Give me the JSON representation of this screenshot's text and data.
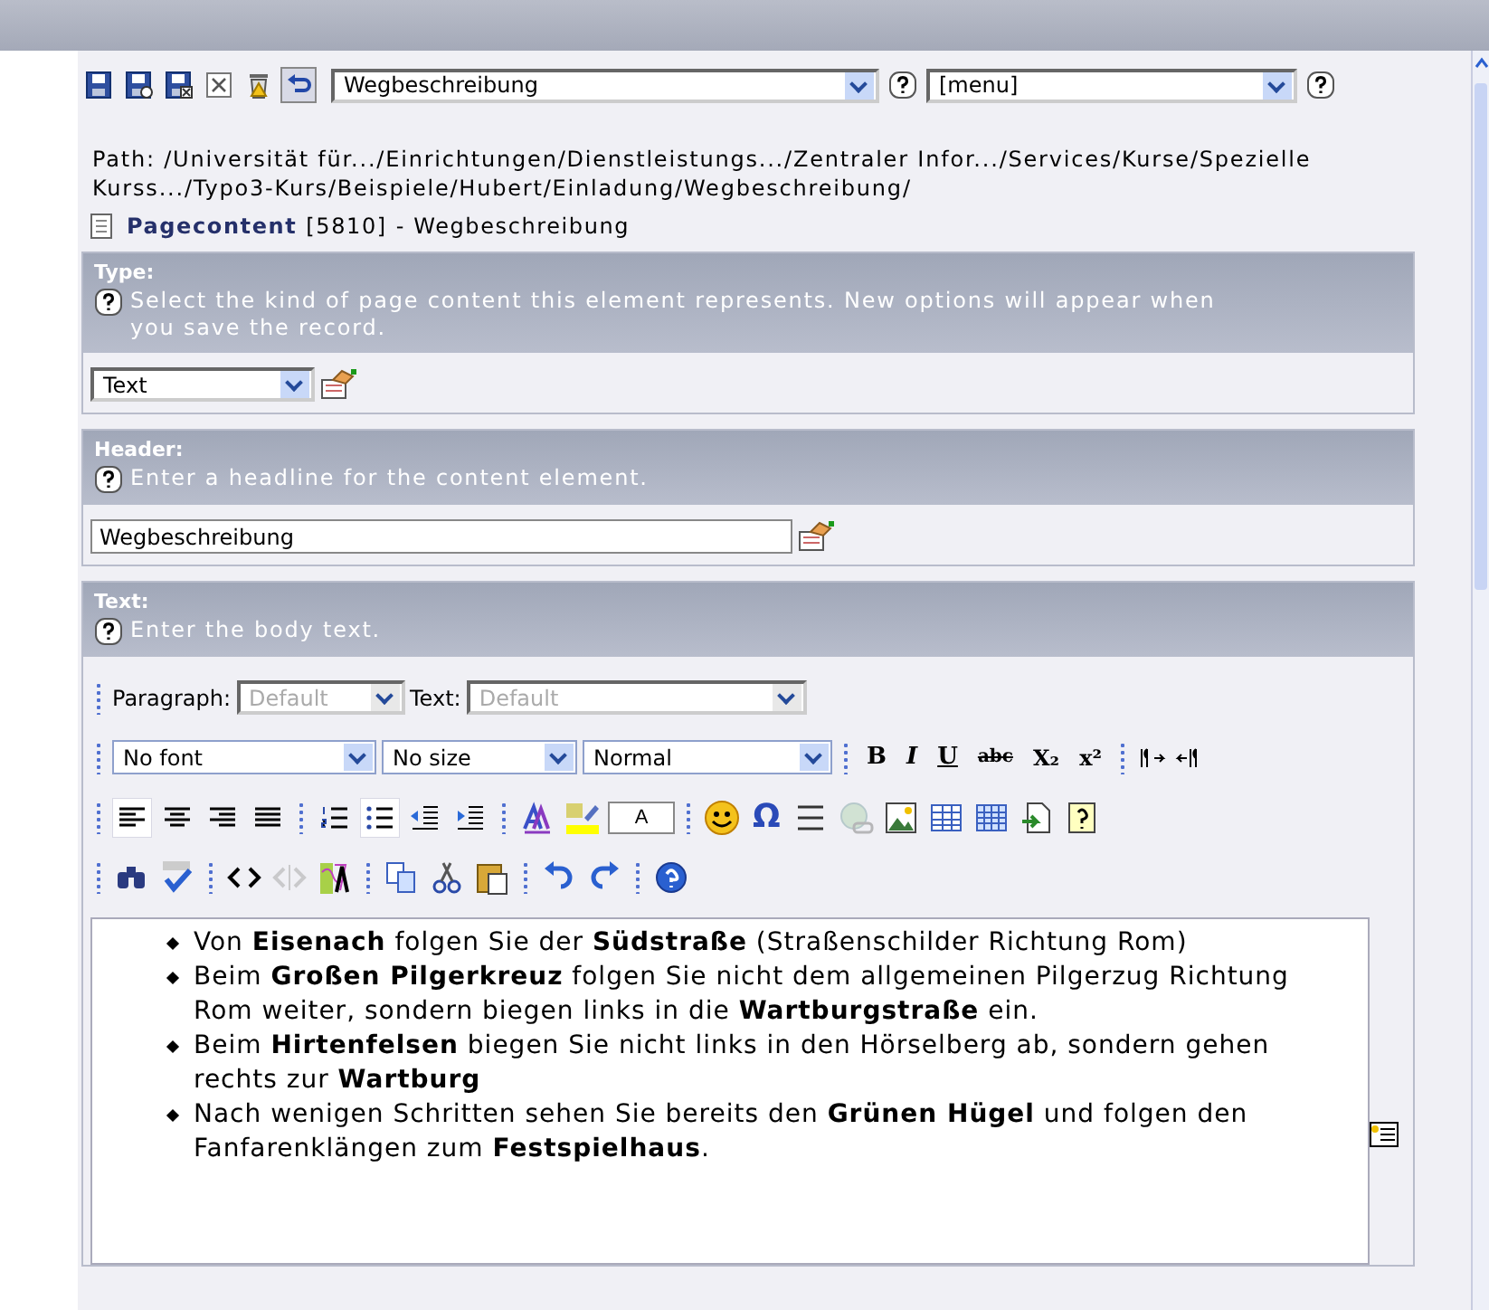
{
  "toolbar": {
    "buttons": [
      {
        "kind": "save"
      },
      {
        "kind": "save-view"
      },
      {
        "kind": "save-close"
      },
      {
        "kind": "close"
      },
      {
        "kind": "delete"
      },
      {
        "kind": "undo"
      }
    ],
    "doc_select": "Wegbeschreibung",
    "menu_select": "[menu]"
  },
  "path": "Path: /Universität für.../Einrichtungen/Dienstleistungs.../Zentraler Infor.../Services/Kurse/Spezielle Kurss.../Typo3-Kurs/Beispiele/Hubert/Einladung/Wegbeschreibung/",
  "record": {
    "table": "Pagecontent",
    "uid": "[5810]",
    "title": "- Wegbeschreibung"
  },
  "fields": [
    {
      "kind": "select",
      "label": "Type:",
      "help": "Select the kind of page content this element represents. New options will appear when you save the record.",
      "value": "Text"
    },
    {
      "kind": "input",
      "label": "Header:",
      "help": "Enter a headline for the content element.",
      "value": "Wegbeschreibung"
    },
    {
      "kind": "rte",
      "label": "Text:",
      "help": "Enter the body text."
    }
  ],
  "rte": {
    "paragraph_label": "Paragraph:",
    "paragraph_value": "Default",
    "text_label": "Text:",
    "text_value": "Default",
    "font": "No font",
    "size": "No size",
    "format": "Normal",
    "format_buttons": [
      "B",
      "I",
      "U",
      "abc",
      "X₂",
      "x²"
    ],
    "tool_rows": [
      [
        {
          "kind": "align-left",
          "active": true
        },
        {
          "kind": "align-center",
          "active": false
        },
        {
          "kind": "align-right",
          "active": false
        },
        {
          "kind": "justify",
          "active": false
        },
        {
          "kind": "sep"
        },
        {
          "kind": "ordered-list",
          "active": false
        },
        {
          "kind": "bullet-list",
          "active": true
        },
        {
          "kind": "outdent",
          "active": false
        },
        {
          "kind": "indent",
          "active": false
        },
        {
          "kind": "sep"
        },
        {
          "kind": "font-color",
          "active": false
        },
        {
          "kind": "highlight",
          "active": false
        },
        {
          "kind": "style-box",
          "label": "A"
        },
        {
          "kind": "sep"
        },
        {
          "kind": "smiley",
          "active": false
        },
        {
          "kind": "char",
          "label": "Ω"
        },
        {
          "kind": "rule",
          "active": false
        },
        {
          "kind": "link",
          "active": false,
          "disabled": true
        },
        {
          "kind": "image",
          "active": false
        },
        {
          "kind": "table",
          "active": false
        },
        {
          "kind": "table-grid",
          "active": false
        },
        {
          "kind": "insert",
          "active": false
        },
        {
          "kind": "help-page",
          "active": false
        }
      ],
      [
        {
          "kind": "find",
          "active": false
        },
        {
          "kind": "spellcheck",
          "active": false
        },
        {
          "kind": "sep"
        },
        {
          "kind": "code",
          "active": false
        },
        {
          "kind": "code",
          "active": false,
          "disabled": true
        },
        {
          "kind": "clean",
          "active": false
        },
        {
          "kind": "sep"
        },
        {
          "kind": "copy",
          "active": false
        },
        {
          "kind": "cut",
          "active": false
        },
        {
          "kind": "paste",
          "active": false
        },
        {
          "kind": "sep"
        },
        {
          "kind": "undo",
          "active": false
        },
        {
          "kind": "redo",
          "active": false
        },
        {
          "kind": "sep"
        },
        {
          "kind": "help",
          "active": false
        }
      ]
    ],
    "content": [
      "Von **Eisenach** folgen Sie der **Südstraße** (Straßenschilder Richtung Rom)",
      "Beim **Großen Pilgerkreuz** folgen Sie nicht dem allgemeinen Pilgerzug Richtung Rom weiter, sondern biegen links in die **Wartburgstraße** ein.",
      "Beim **Hirtenfelsen** biegen Sie nicht links in den Hörselberg ab, sondern gehen rechts zur **Wartburg**",
      "Nach wenigen Schritten sehen Sie bereits den **Grünen Hügel** und folgen den Fanfarenklängen zum **Festspielhaus**."
    ]
  }
}
